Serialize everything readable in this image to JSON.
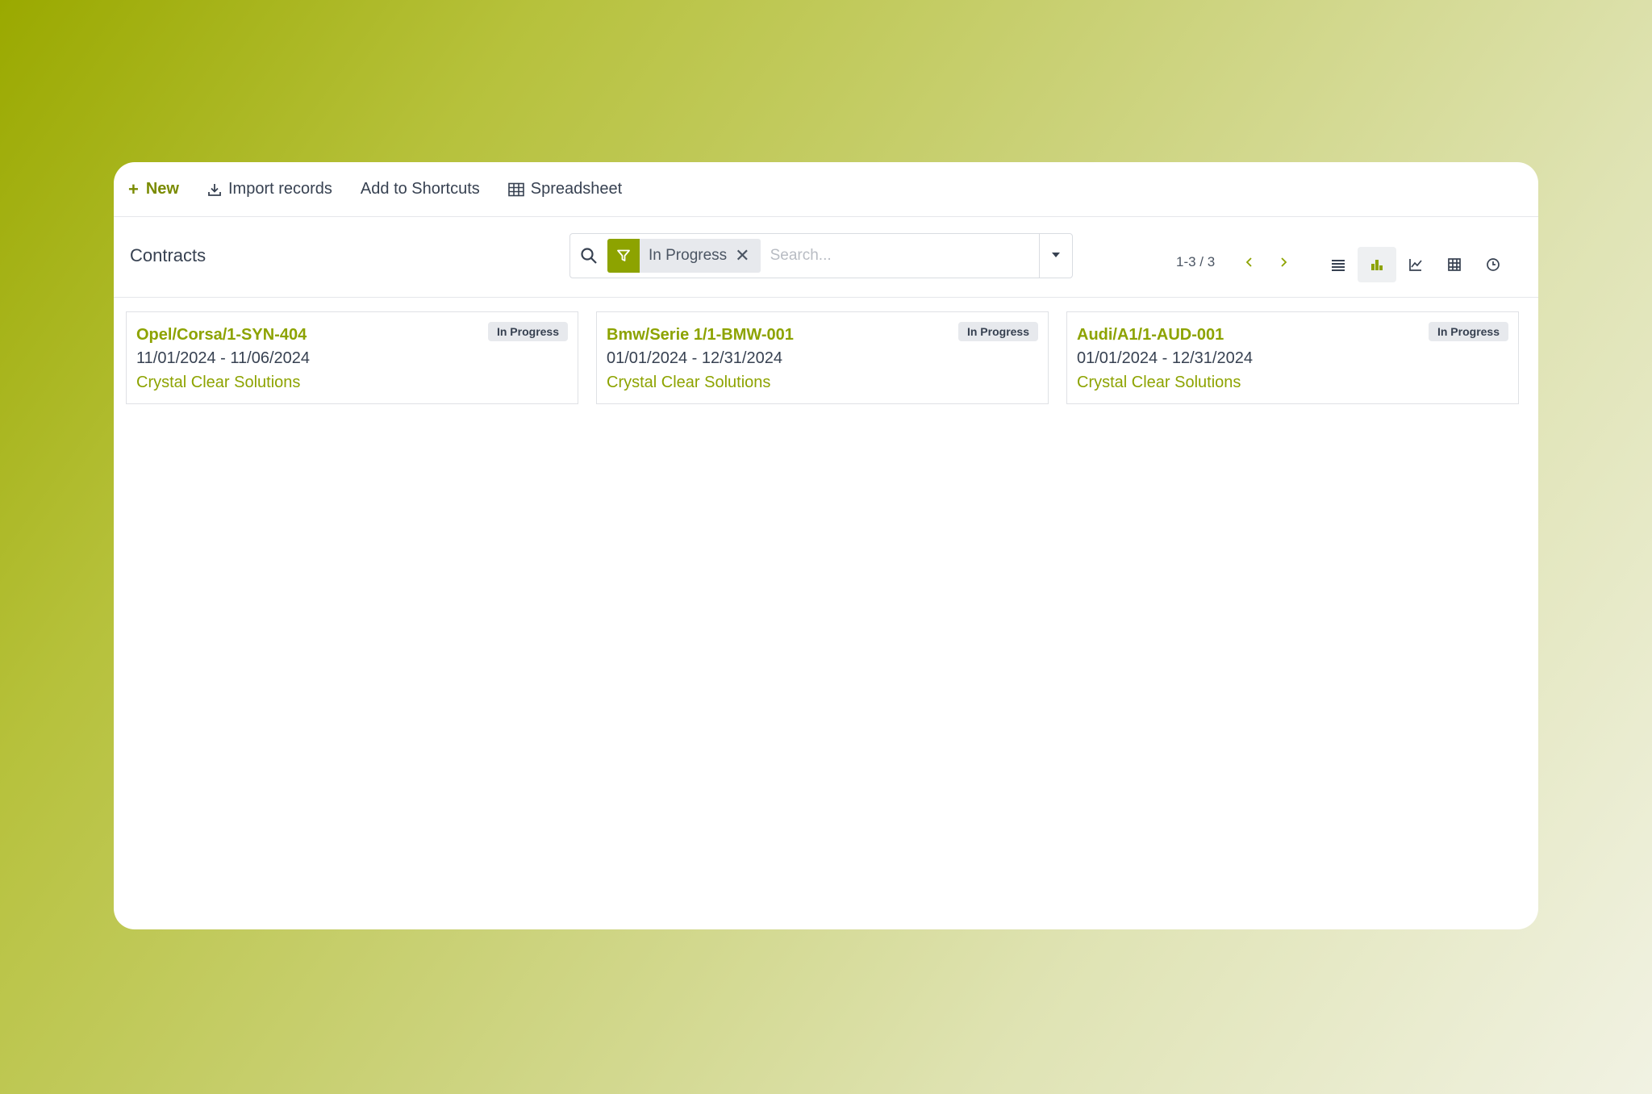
{
  "toolbar": {
    "new_label": "New",
    "import_label": "Import records",
    "shortcuts_label": "Add to Shortcuts",
    "spreadsheet_label": "Spreadsheet"
  },
  "control": {
    "title": "Contracts",
    "filter_facet": "In Progress",
    "search_placeholder": "Search...",
    "pager": "1-3 / 3",
    "views": [
      "list-view-icon",
      "kanban-view-icon",
      "graph-view-icon",
      "pivot-view-icon",
      "activity-view-icon"
    ],
    "active_view": "kanban-view-icon"
  },
  "cards": [
    {
      "title": "Opel/Corsa/1-SYN-404",
      "dates": "11/01/2024 - 11/06/2024",
      "company": "Crystal Clear Solutions",
      "status": "In Progress"
    },
    {
      "title": "Bmw/Serie 1/1-BMW-001",
      "dates": "01/01/2024 - 12/31/2024",
      "company": "Crystal Clear Solutions",
      "status": "In Progress"
    },
    {
      "title": "Audi/A1/1-AUD-001",
      "dates": "01/01/2024 - 12/31/2024",
      "company": "Crystal Clear Solutions",
      "status": "In Progress"
    }
  ],
  "colors": {
    "accent": "#8da300",
    "badge_bg": "#e7e9ed",
    "text": "#374151"
  }
}
